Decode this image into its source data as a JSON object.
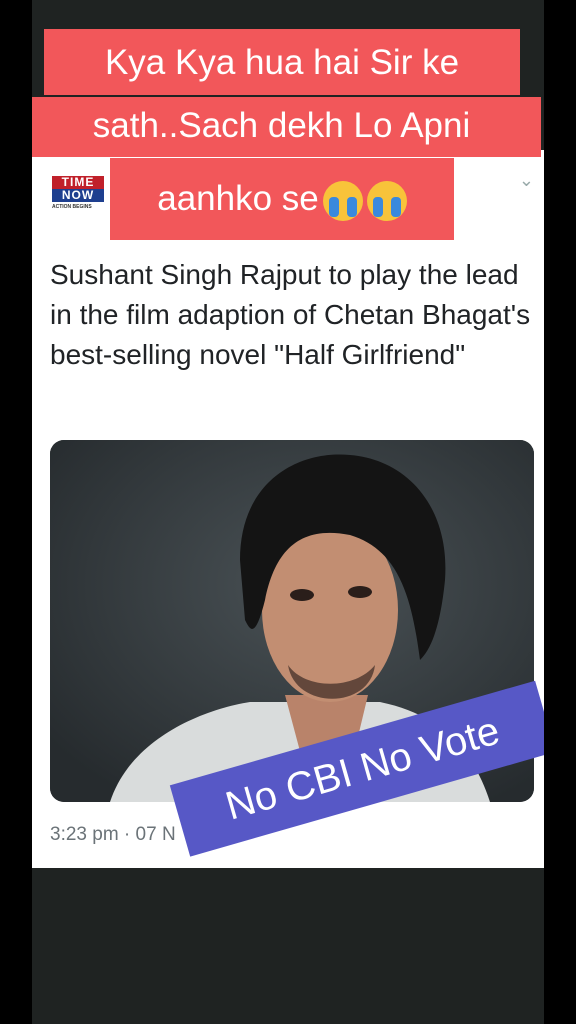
{
  "overlay": {
    "line1": "Kya Kya hua hai Sir ke",
    "line2": "sath..Sach dekh Lo Apni",
    "line3": "aanhko se",
    "emoji": "loudly-crying-face-emoji",
    "sticker": "No CBI No Vote"
  },
  "card": {
    "logo_line1": "TIME",
    "logo_line2": "NOW",
    "logo_tagline": "ACTION BEGINS",
    "tweet_text": "Sushant Singh Rajput to play the lead in the film adaption of Chetan Bhagat's best-selling novel \"Half Girlfriend\"",
    "timestamp": "3:23 pm · 07 N",
    "chevron_icon": "chevron-down-icon"
  },
  "colors": {
    "banner": "#f2575a",
    "sticker": "#5758c6",
    "background": "#1f2322"
  }
}
